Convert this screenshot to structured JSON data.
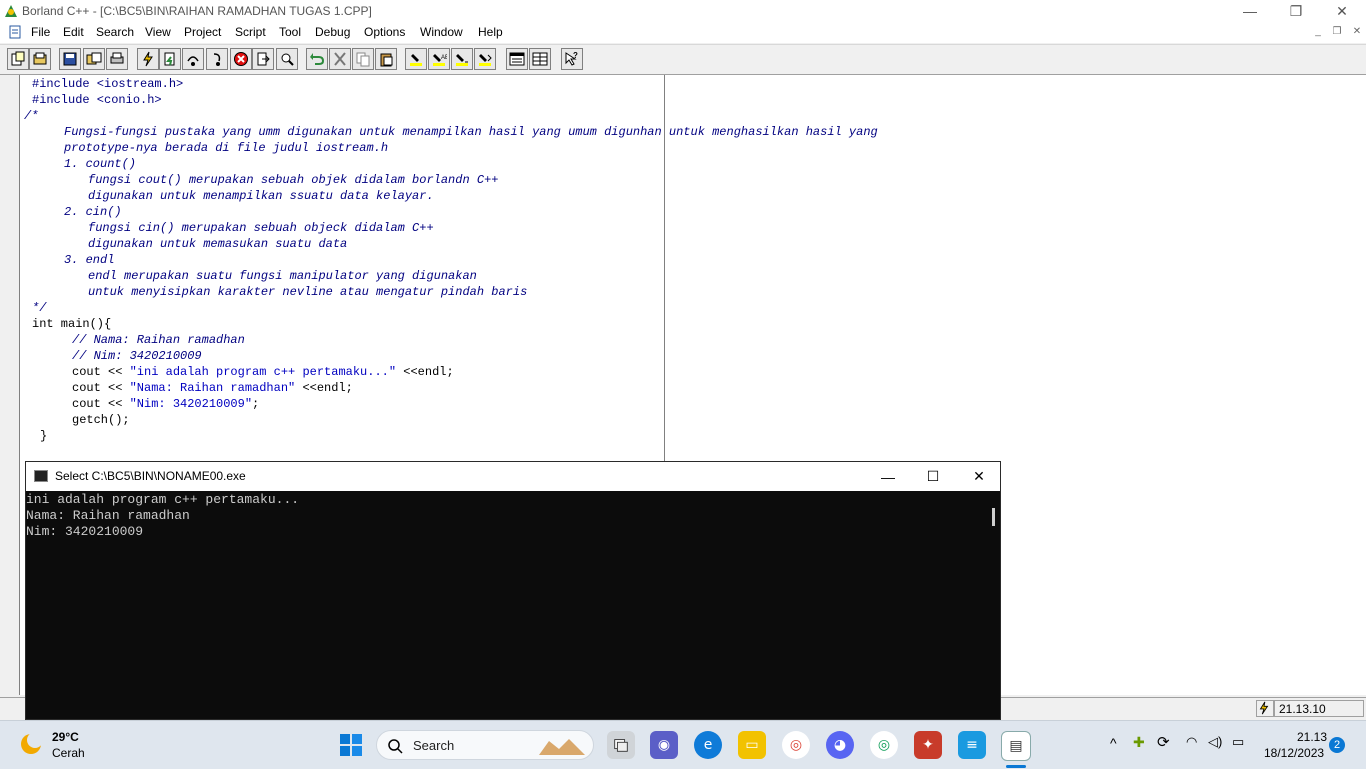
{
  "window": {
    "title": "Borland C++ - [C:\\BC5\\BIN\\RAIHAN RAMADHAN TUGAS 1.CPP]",
    "min": "—",
    "max": "❐",
    "close": "✕"
  },
  "menu": [
    "File",
    "Edit",
    "Search",
    "View",
    "Project",
    "Script",
    "Tool",
    "Debug",
    "Options",
    "Window",
    "Help"
  ],
  "mdi": {
    "min": "_",
    "restore": "❐",
    "close": "✕"
  },
  "editor": {
    "lines": [
      {
        "t": "#include <iostream.h>",
        "c": "pp",
        "x": 32
      },
      {
        "t": "#include <conio.h>",
        "c": "pp",
        "x": 32
      },
      {
        "t": "/*",
        "c": "cm",
        "x": 24
      },
      {
        "t": "Fungsi-fungsi pustaka yang umm digunakan untuk menampilkan hasil yang umum digunhan untuk menghasilkan hasil yang",
        "c": "cm",
        "x": 64
      },
      {
        "t": "prototype-nya berada di file judul iostream.h",
        "c": "cm",
        "x": 64
      },
      {
        "t": "1. count()",
        "c": "cm",
        "x": 64
      },
      {
        "t": "fungsi cout() merupakan sebuah objek didalam borlandn C++",
        "c": "cm",
        "x": 88
      },
      {
        "t": "digunakan untuk menampilkan ssuatu data kelayar.",
        "c": "cm",
        "x": 88
      },
      {
        "t": "2. cin()",
        "c": "cm",
        "x": 64
      },
      {
        "t": "fungsi cin() merupakan sebuah objeck didalam C++",
        "c": "cm",
        "x": 88
      },
      {
        "t": "digunakan untuk memasukan suatu data",
        "c": "cm",
        "x": 88
      },
      {
        "t": "3. endl",
        "c": "cm",
        "x": 64
      },
      {
        "t": "endl merupakan suatu fungsi manipulator yang digunakan",
        "c": "cm",
        "x": 88
      },
      {
        "t": "untuk menyisipkan karakter nevline atau mengatur pindah baris",
        "c": "cm",
        "x": 88
      },
      {
        "t": "*/",
        "c": "cm",
        "x": 32
      },
      {
        "t": "int main(){",
        "c": "kw",
        "x": 32
      },
      {
        "t": "// Nama: Raihan ramadhan",
        "c": "cm",
        "x": 72
      },
      {
        "t": "// Nim: 3420210009",
        "c": "cm",
        "x": 72
      }
    ],
    "cout1_pre": "cout << ",
    "cout1_str": "\"ini adalah program c++ pertamaku...\"",
    "cout1_post": " <<endl;",
    "cout2_pre": "cout << ",
    "cout2_str": "\"Nama: Raihan ramadhan\"",
    "cout2_post": " <<endl;",
    "cout3_pre": "cout << ",
    "cout3_str": "\"Nim: 3420210009\"",
    "cout3_post": ";",
    "getch": "getch();",
    "close_brace": "}"
  },
  "status": {
    "time": "21.13.10"
  },
  "console": {
    "title": "Select C:\\BC5\\BIN\\NONAME00.exe",
    "output": [
      "ini adalah program c++ pertamaku...",
      "Nama: Raihan ramadhan",
      "Nim: 3420210009"
    ]
  },
  "taskbar": {
    "weather_temp": "29°C",
    "weather_desc": "Cerah",
    "search_label": "Search",
    "clock_time": "21.13",
    "clock_date": "18/12/2023",
    "notification_count": "2"
  }
}
